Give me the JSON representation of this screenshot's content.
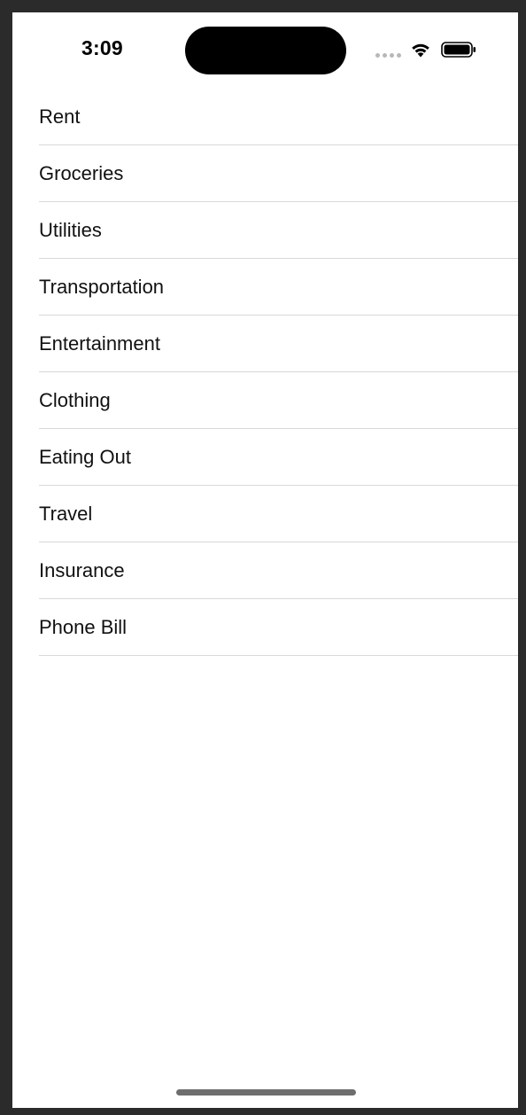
{
  "status_bar": {
    "time": "3:09",
    "icons": [
      "cellular-signal-icon",
      "wifi-icon",
      "battery-icon"
    ]
  },
  "list": {
    "items": [
      {
        "label": "Rent"
      },
      {
        "label": "Groceries"
      },
      {
        "label": "Utilities"
      },
      {
        "label": "Transportation"
      },
      {
        "label": "Entertainment"
      },
      {
        "label": "Clothing"
      },
      {
        "label": "Eating Out"
      },
      {
        "label": "Travel"
      },
      {
        "label": "Insurance"
      },
      {
        "label": "Phone Bill"
      }
    ]
  },
  "colors": {
    "background": "#ffffff",
    "frame": "#2b2b2b",
    "separator": "#d8d8d8",
    "text": "#111111"
  }
}
